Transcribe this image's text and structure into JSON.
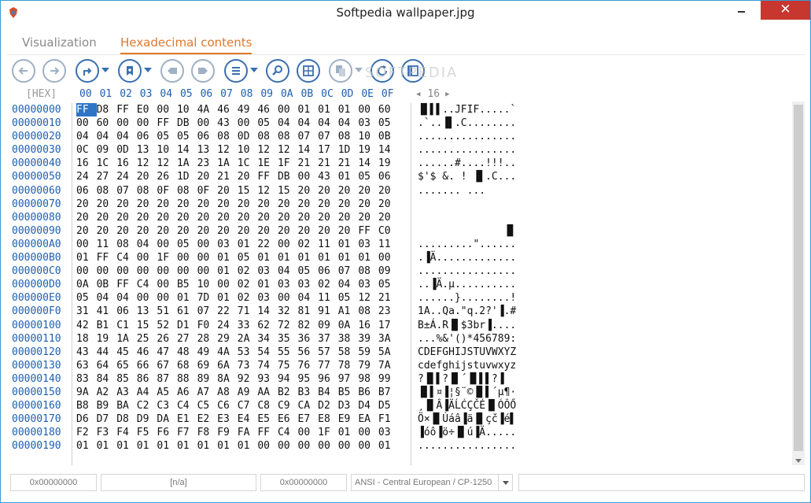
{
  "window": {
    "title": "Softpedia wallpaper.jpg",
    "close_glyph": "✕"
  },
  "tabs": [
    {
      "label": "Visualization",
      "active": false
    },
    {
      "label": "Hexadecimal contents",
      "active": true
    }
  ],
  "toolbar": {
    "buttons": [
      {
        "icon": "back-arrow-icon"
      },
      {
        "icon": "forward-arrow-icon"
      },
      {
        "icon": "jump-icon"
      },
      {
        "icon": "bookmark-icon"
      },
      {
        "icon": "prev-bookmark-icon"
      },
      {
        "icon": "next-bookmark-icon"
      },
      {
        "icon": "list-icon"
      },
      {
        "icon": "search-icon"
      },
      {
        "icon": "select-block-icon"
      },
      {
        "icon": "copy-icon"
      },
      {
        "icon": "refresh-icon"
      },
      {
        "icon": "panel-icon"
      }
    ],
    "watermark": "SOFTPEDIA"
  },
  "hex_view": {
    "mode_label": "[HEX]",
    "column_headers": [
      "00",
      "01",
      "02",
      "03",
      "04",
      "05",
      "06",
      "07",
      "08",
      "09",
      "0A",
      "0B",
      "0C",
      "0D",
      "0E",
      "0F"
    ],
    "page_size": "16",
    "rows": [
      {
        "offset": "00000000",
        "bytes": [
          "FF",
          "D8",
          "FF",
          "E0",
          "00",
          "10",
          "4A",
          "46",
          "49",
          "46",
          "00",
          "01",
          "01",
          "01",
          "00",
          "60"
        ],
        "ascii": "▐▌▌▌..JFIF.....`"
      },
      {
        "offset": "00000010",
        "bytes": [
          "00",
          "60",
          "00",
          "00",
          "FF",
          "DB",
          "00",
          "43",
          "00",
          "05",
          "04",
          "04",
          "04",
          "04",
          "03",
          "05"
        ],
        "ascii": ".`..▐▌.C........"
      },
      {
        "offset": "00000020",
        "bytes": [
          "04",
          "04",
          "04",
          "06",
          "05",
          "05",
          "06",
          "08",
          "0D",
          "08",
          "08",
          "07",
          "07",
          "08",
          "10",
          "0B"
        ],
        "ascii": "................"
      },
      {
        "offset": "00000030",
        "bytes": [
          "0C",
          "09",
          "0D",
          "13",
          "10",
          "14",
          "13",
          "12",
          "10",
          "12",
          "12",
          "14",
          "17",
          "1D",
          "19",
          "14"
        ],
        "ascii": "................"
      },
      {
        "offset": "00000040",
        "bytes": [
          "16",
          "1C",
          "16",
          "12",
          "12",
          "1A",
          "23",
          "1A",
          "1C",
          "1E",
          "1F",
          "21",
          "21",
          "21",
          "14",
          "19"
        ],
        "ascii": "......#....!!!.."
      },
      {
        "offset": "00000050",
        "bytes": [
          "24",
          "27",
          "24",
          "20",
          "26",
          "1D",
          "20",
          "21",
          "20",
          "FF",
          "DB",
          "00",
          "43",
          "01",
          "05",
          "06"
        ],
        "ascii": "$'$ &. ! ▐▌.C..."
      },
      {
        "offset": "00000060",
        "bytes": [
          "06",
          "08",
          "07",
          "08",
          "0F",
          "08",
          "0F",
          "20",
          "15",
          "12",
          "15",
          "20",
          "20",
          "20",
          "20",
          "20"
        ],
        "ascii": "....... ...     "
      },
      {
        "offset": "00000070",
        "bytes": [
          "20",
          "20",
          "20",
          "20",
          "20",
          "20",
          "20",
          "20",
          "20",
          "20",
          "20",
          "20",
          "20",
          "20",
          "20",
          "20"
        ],
        "ascii": "                "
      },
      {
        "offset": "00000080",
        "bytes": [
          "20",
          "20",
          "20",
          "20",
          "20",
          "20",
          "20",
          "20",
          "20",
          "20",
          "20",
          "20",
          "20",
          "20",
          "20",
          "20"
        ],
        "ascii": "                "
      },
      {
        "offset": "00000090",
        "bytes": [
          "20",
          "20",
          "20",
          "20",
          "20",
          "20",
          "20",
          "20",
          "20",
          "20",
          "20",
          "20",
          "20",
          "20",
          "FF",
          "C0"
        ],
        "ascii": "              ▐▌"
      },
      {
        "offset": "000000A0",
        "bytes": [
          "00",
          "11",
          "08",
          "04",
          "00",
          "05",
          "00",
          "03",
          "01",
          "22",
          "00",
          "02",
          "11",
          "01",
          "03",
          "11"
        ],
        "ascii": ".........\"......"
      },
      {
        "offset": "000000B0",
        "bytes": [
          "01",
          "FF",
          "C4",
          "00",
          "1F",
          "00",
          "00",
          "01",
          "05",
          "01",
          "01",
          "01",
          "01",
          "01",
          "01",
          "00"
        ],
        "ascii": ".▐Ä............."
      },
      {
        "offset": "000000C0",
        "bytes": [
          "00",
          "00",
          "00",
          "00",
          "00",
          "00",
          "00",
          "01",
          "02",
          "03",
          "04",
          "05",
          "06",
          "07",
          "08",
          "09"
        ],
        "ascii": "................"
      },
      {
        "offset": "000000D0",
        "bytes": [
          "0A",
          "0B",
          "FF",
          "C4",
          "00",
          "B5",
          "10",
          "00",
          "02",
          "01",
          "03",
          "03",
          "02",
          "04",
          "03",
          "05"
        ],
        "ascii": "..▐Ä.µ.........."
      },
      {
        "offset": "000000E0",
        "bytes": [
          "05",
          "04",
          "04",
          "00",
          "00",
          "01",
          "7D",
          "01",
          "02",
          "03",
          "00",
          "04",
          "11",
          "05",
          "12",
          "21"
        ],
        "ascii": "......}........!"
      },
      {
        "offset": "000000F0",
        "bytes": [
          "31",
          "41",
          "06",
          "13",
          "51",
          "61",
          "07",
          "22",
          "71",
          "14",
          "32",
          "81",
          "91",
          "A1",
          "08",
          "23"
        ],
        "ascii": "1A..Qa.\"q.2?'▐.#"
      },
      {
        "offset": "00000100",
        "bytes": [
          "42",
          "B1",
          "C1",
          "15",
          "52",
          "D1",
          "F0",
          "24",
          "33",
          "62",
          "72",
          "82",
          "09",
          "0A",
          "16",
          "17"
        ],
        "ascii": "B±Á.R▐▌$3br▐...."
      },
      {
        "offset": "00000110",
        "bytes": [
          "18",
          "19",
          "1A",
          "25",
          "26",
          "27",
          "28",
          "29",
          "2A",
          "34",
          "35",
          "36",
          "37",
          "38",
          "39",
          "3A"
        ],
        "ascii": "...%&'()*456789:"
      },
      {
        "offset": "00000120",
        "bytes": [
          "43",
          "44",
          "45",
          "46",
          "47",
          "48",
          "49",
          "4A",
          "53",
          "54",
          "55",
          "56",
          "57",
          "58",
          "59",
          "5A"
        ],
        "ascii": "CDEFGHIJSTUVWXYZ"
      },
      {
        "offset": "00000130",
        "bytes": [
          "63",
          "64",
          "65",
          "66",
          "67",
          "68",
          "69",
          "6A",
          "73",
          "74",
          "75",
          "76",
          "77",
          "78",
          "79",
          "7A"
        ],
        "ascii": "cdefghijstuvwxyz"
      },
      {
        "offset": "00000140",
        "bytes": [
          "83",
          "84",
          "85",
          "86",
          "87",
          "88",
          "89",
          "8A",
          "92",
          "93",
          "94",
          "95",
          "96",
          "97",
          "98",
          "99"
        ],
        "ascii": "?▐▌▌?▐▌´▐▌▌▌?▐"
      },
      {
        "offset": "00000150",
        "bytes": [
          "9A",
          "A2",
          "A3",
          "A4",
          "A5",
          "A6",
          "A7",
          "A8",
          "A9",
          "AA",
          "B2",
          "B3",
          "B4",
          "B5",
          "B6",
          "B7"
        ],
        "ascii": "▐▌▌¤▐¦§¨©▐▌▌´µ¶·"
      },
      {
        "offset": "00000160",
        "bytes": [
          "B8",
          "B9",
          "BA",
          "C2",
          "C3",
          "C4",
          "C5",
          "C6",
          "C7",
          "C8",
          "C9",
          "CA",
          "D2",
          "D3",
          "D4",
          "D5"
        ],
        "ascii": "¸▐▌Â▐ÄĹĆÇČÉ▐▌ÓÔŐ"
      },
      {
        "offset": "00000170",
        "bytes": [
          "D6",
          "D7",
          "D8",
          "D9",
          "DA",
          "E1",
          "E2",
          "E3",
          "E4",
          "E5",
          "E6",
          "E7",
          "E8",
          "E9",
          "EA",
          "F1"
        ],
        "ascii": "Ö×▐▌Úáâ▐ä▐▌çč▐é▌"
      },
      {
        "offset": "00000180",
        "bytes": [
          "F2",
          "F3",
          "F4",
          "F5",
          "F6",
          "F7",
          "F8",
          "F9",
          "FA",
          "FF",
          "C4",
          "00",
          "1F",
          "01",
          "00",
          "03"
        ],
        "ascii": "▐óô▐ö÷▐▌ú▐Ä....."
      },
      {
        "offset": "00000190",
        "bytes": [
          "01",
          "01",
          "01",
          "01",
          "01",
          "01",
          "01",
          "01",
          "01",
          "00",
          "00",
          "00",
          "00",
          "00",
          "00",
          "01"
        ],
        "ascii": "................"
      }
    ]
  },
  "status": {
    "offset_a": "0x00000000",
    "value": "[n/a]",
    "offset_b": "0x00000000",
    "encoding": "ANSI - Central European / CP-1250",
    "extra": ""
  },
  "colors": {
    "accent": "#e0782b",
    "offset_blue": "#1f5fb0",
    "selection": "#2e74c4",
    "close_red": "#c7372f"
  }
}
